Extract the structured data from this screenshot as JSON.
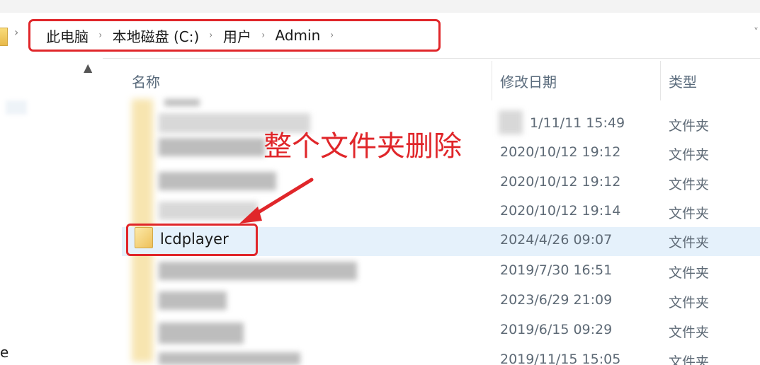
{
  "breadcrumb": {
    "items": [
      "此电脑",
      "本地磁盘 (C:)",
      "用户",
      "Admin"
    ],
    "separator": "›"
  },
  "columns": {
    "name": "名称",
    "modified": "修改日期",
    "type": "类型"
  },
  "rows": [
    {
      "name": "",
      "modified": "",
      "type": ""
    },
    {
      "name": "",
      "modified": "1/11/11 15:49",
      "type": "文件夹"
    },
    {
      "name": "",
      "modified": "2020/10/12 19:12",
      "type": "文件夹"
    },
    {
      "name": "",
      "modified": "2020/10/12 19:12",
      "type": "文件夹"
    },
    {
      "name": "",
      "modified": "2020/10/12 19:14",
      "type": "文件夹"
    },
    {
      "name": "lcdplayer",
      "modified": "2024/4/26 09:07",
      "type": "文件夹",
      "selected": true
    },
    {
      "name": "",
      "modified": "2019/7/30 16:51",
      "type": "文件夹"
    },
    {
      "name": "",
      "modified": "2023/6/29 21:09",
      "type": "文件夹"
    },
    {
      "name": "",
      "modified": "2019/6/15 09:29",
      "type": "文件夹"
    },
    {
      "name": "",
      "modified": "2019/11/15 15:05",
      "type": "文件夹"
    }
  ],
  "annotation": {
    "text": "整个文件夹删除"
  },
  "nav": {
    "bottom_text": "e"
  },
  "colors": {
    "highlight_red": "#e0262a",
    "selected_row": "#e5f1fb",
    "folder_yellow": "#f5d471"
  },
  "icons": {
    "folder": "folder-icon",
    "scroll_up": "chevron-up-icon",
    "breadcrumb_sep": "chevron-right-icon"
  }
}
